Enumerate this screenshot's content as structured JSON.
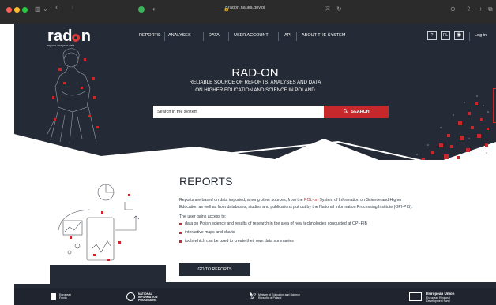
{
  "browser": {
    "url": "radon.nauka.gov.pl"
  },
  "site": {
    "logo": {
      "word": "rad",
      "word_end": "n",
      "tagline": "reports   analyses   data"
    },
    "nav": [
      {
        "label": "REPORTS"
      },
      {
        "label": "ANALYSES"
      },
      {
        "label": "DATA"
      },
      {
        "label": "USER ACCOUNT"
      },
      {
        "label": "API"
      },
      {
        "label": "ABOUT THE SYSTEM"
      }
    ],
    "help": "?",
    "lang": "PL",
    "login": "Log in"
  },
  "hero": {
    "title": "RAD-ON",
    "subtitle_line1": "RELIABLE SOURCE OF REPORTS, ANALYSES AND DATA",
    "subtitle_line2": "ON HIGHER EDUCATION AND SCIENCE IN POLAND",
    "search_value": "Search in the system",
    "search_button": "SEARCH"
  },
  "reports": {
    "heading": "REPORTS",
    "p1_a": "Reports are based on data imported, among other sources, from the ",
    "p1_link": "POL-on",
    "p1_b": " System of Information on Science and Higher",
    "p2": "Education as well as from databases, studies and publications put out by the National Information Processing Institute (OPI-PIB).",
    "p3": "The user gains access to:",
    "bullets": [
      "data on Polish science and results of research in the area of new technologies conducted at OPI-PIB",
      "interactive maps and charts",
      "tools which can be used to create their own data summaries"
    ],
    "button": "GO TO REPORTS"
  },
  "footer": {
    "logo1_l1": "European",
    "logo1_l2": "Funds",
    "logo2_l1": "NATIONAL",
    "logo2_l2": "INFORMATION",
    "logo2_l3": "PROCESSING",
    "logo3_l1": "Minister of Education and Science",
    "logo3_l2": "Republic of Poland",
    "logo4_l1": "European Union",
    "logo4_l2": "European Regional",
    "logo4_l3": "Development Fund"
  },
  "colors": {
    "brand_red": "#c6282c",
    "navy": "#252b36",
    "white": "#ffffff"
  },
  "icons": [
    "sidebar-icon",
    "back-icon",
    "forward-icon",
    "shield-icon",
    "lock-icon",
    "translate-icon",
    "reload-icon",
    "download-icon",
    "share-icon",
    "new-tab-icon",
    "search-icon",
    "eye-icon"
  ]
}
